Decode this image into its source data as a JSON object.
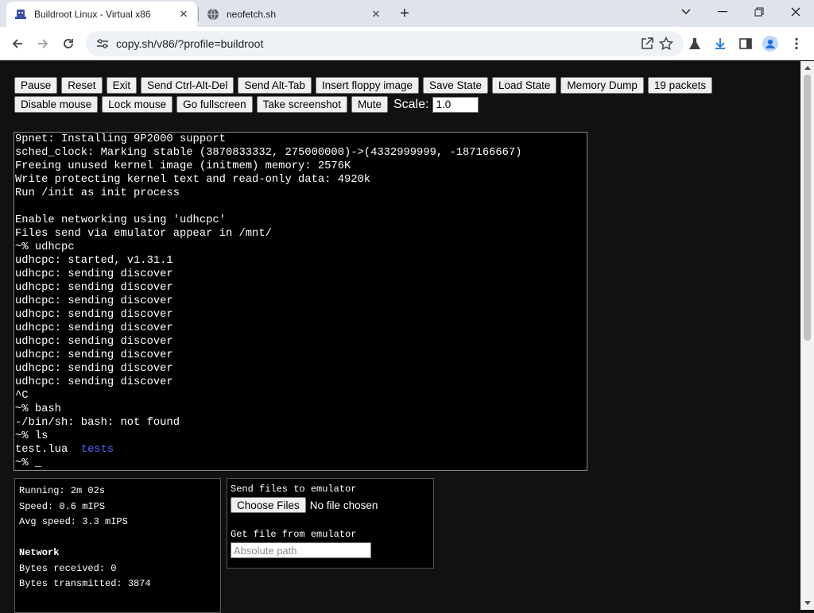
{
  "browser": {
    "tabs": [
      {
        "title": "Buildroot Linux - Virtual x86",
        "active": true
      },
      {
        "title": "neofetch.sh",
        "active": false
      }
    ],
    "url": "copy.sh/v86/?profile=buildroot"
  },
  "controls": {
    "row1": [
      "Pause",
      "Reset",
      "Exit",
      "Send Ctrl-Alt-Del",
      "Send Alt-Tab",
      "Insert floppy image",
      "Save State",
      "Load State",
      "Memory Dump",
      "19 packets"
    ],
    "row2": [
      "Disable mouse",
      "Lock mouse",
      "Go fullscreen",
      "Take screenshot",
      "Mute"
    ],
    "scale_label": "Scale:",
    "scale_value": "1.0"
  },
  "terminal": {
    "lines": [
      "9pnet: Installing 9P2000 support",
      "sched_clock: Marking stable (3870833332, 275000000)->(4332999999, -187166667)",
      "Freeing unused kernel image (initmem) memory: 2576K",
      "Write protecting kernel text and read-only data: 4920k",
      "Run /init as init process",
      "",
      "Enable networking using 'udhcpc'",
      "Files send via emulator appear in /mnt/",
      "~% udhcpc",
      "udhcpc: started, v1.31.1",
      "udhcpc: sending discover",
      "udhcpc: sending discover",
      "udhcpc: sending discover",
      "udhcpc: sending discover",
      "udhcpc: sending discover",
      "udhcpc: sending discover",
      "udhcpc: sending discover",
      "udhcpc: sending discover",
      "udhcpc: sending discover",
      "^C",
      "~% bash",
      "-/bin/sh: bash: not found",
      "~% ls"
    ],
    "ls_file": "test.lua",
    "ls_dir": "tests",
    "prompt": "~% _"
  },
  "stats": {
    "running": "Running: 2m 02s",
    "speed": "Speed: 0.6 mIPS",
    "avg_speed": "Avg speed: 3.3 mIPS",
    "network_heading": "Network",
    "bytes_received": "Bytes received: 0",
    "bytes_transmitted": "Bytes transmitted: 3874"
  },
  "files": {
    "send_label": "Send files to emulator",
    "choose_button": "Choose Files",
    "no_file": "No file chosen",
    "get_label": "Get file from emulator",
    "path_placeholder": "Absolute path"
  },
  "colors": {
    "page_bg": "#111111",
    "terminal_bg": "#000000",
    "terminal_text": "#ffffff",
    "dir_color": "#5c5cff"
  },
  "icons": [
    "v86-favicon-icon",
    "globe-icon",
    "close-icon",
    "plus-icon",
    "chevron-down-icon",
    "minimize-icon",
    "restore-icon",
    "window-close-icon",
    "back-arrow-icon",
    "forward-arrow-icon",
    "reload-icon",
    "site-settings-icon",
    "share-icon",
    "star-icon",
    "labs-flask-icon",
    "download-icon",
    "side-panel-icon",
    "profile-icon",
    "kebab-menu-icon"
  ]
}
